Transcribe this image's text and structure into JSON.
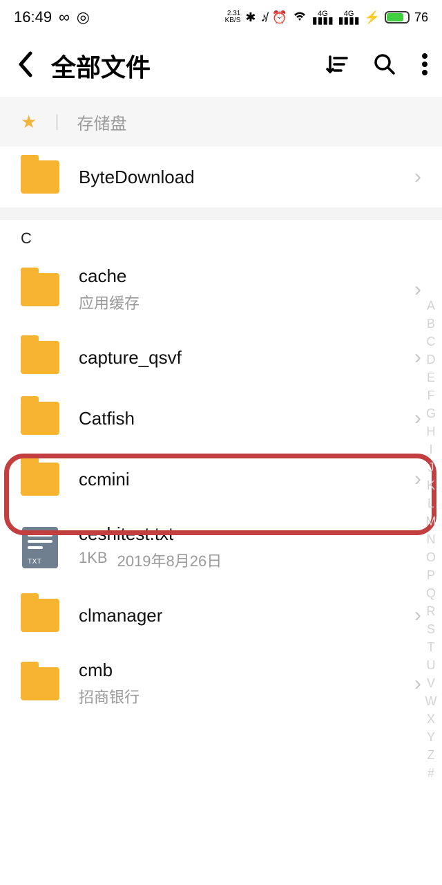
{
  "status": {
    "time": "16:49",
    "net_speed_top": "2.31",
    "net_speed_bot": "KB/S",
    "battery": "76"
  },
  "header": {
    "title": "全部文件"
  },
  "breadcrumb": {
    "storage": "存储盘"
  },
  "sections": [
    {
      "letter": "",
      "items": [
        {
          "name": "ByteDownload",
          "sub": "",
          "type": "folder"
        }
      ]
    },
    {
      "letter": "C",
      "items": [
        {
          "name": "cache",
          "sub": "应用缓存",
          "type": "folder"
        },
        {
          "name": "capture_qsvf",
          "sub": "",
          "type": "folder"
        },
        {
          "name": "Catfish",
          "sub": "",
          "type": "folder",
          "highlighted": true
        },
        {
          "name": "ccmini",
          "sub": "",
          "type": "folder"
        },
        {
          "name": "ceshitest.txt",
          "size": "1KB",
          "date": "2019年8月26日",
          "type": "txt"
        },
        {
          "name": "clmanager",
          "sub": "",
          "type": "folder"
        },
        {
          "name": "cmb",
          "sub": "招商银行",
          "type": "folder"
        }
      ]
    }
  ],
  "alpha_index": [
    "A",
    "B",
    "C",
    "D",
    "E",
    "F",
    "G",
    "H",
    "I",
    "J",
    "K",
    "L",
    "M",
    "N",
    "O",
    "P",
    "Q",
    "R",
    "S",
    "T",
    "U",
    "V",
    "W",
    "X",
    "Y",
    "Z",
    "#"
  ]
}
